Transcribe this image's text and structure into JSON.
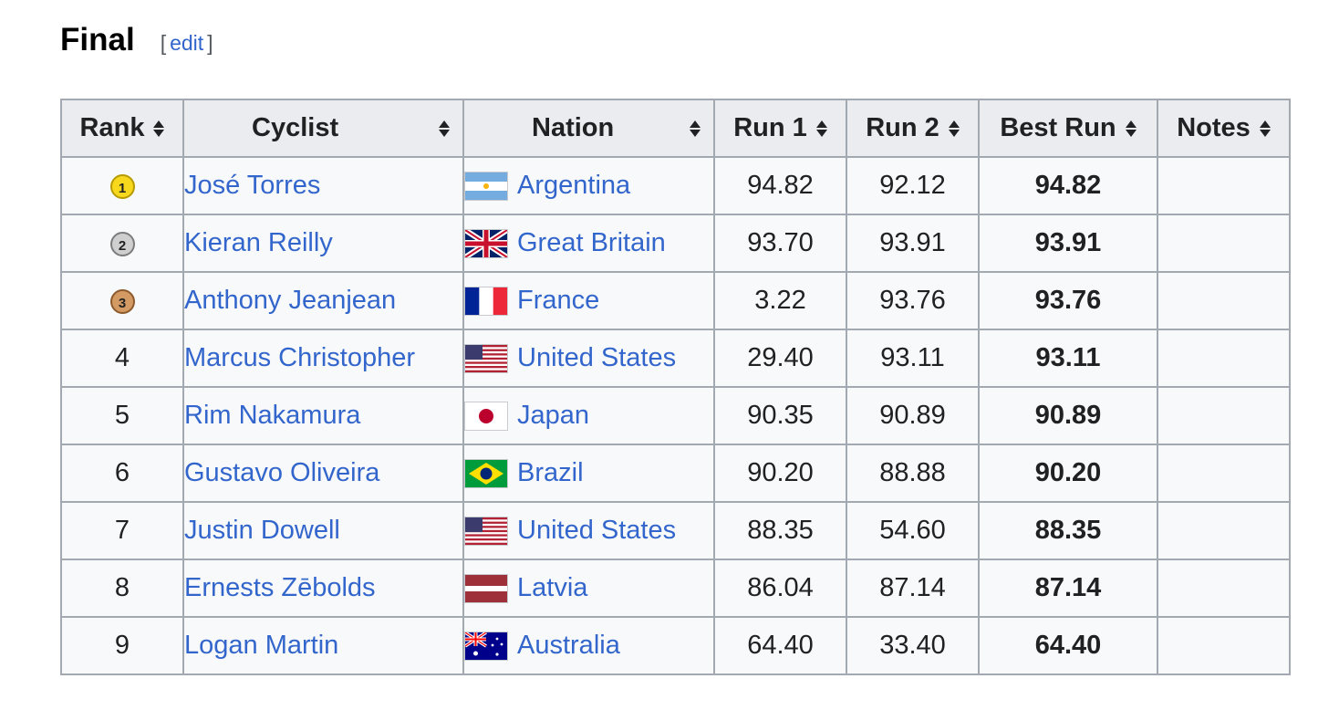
{
  "section": {
    "title": "Final",
    "edit_open": "[",
    "edit_label": "edit",
    "edit_close": "]"
  },
  "table": {
    "headers": [
      "Rank",
      "Cyclist",
      "Nation",
      "Run 1",
      "Run 2",
      "Best Run",
      "Notes"
    ],
    "rows": [
      {
        "rank": "1",
        "medal": "gold",
        "cyclist": "José Torres",
        "nation": "Argentina",
        "flag": "argentina-flag",
        "run1": "94.82",
        "run2": "92.12",
        "best": "94.82",
        "notes": ""
      },
      {
        "rank": "2",
        "medal": "silver",
        "cyclist": "Kieran Reilly",
        "nation": "Great Britain",
        "flag": "great-britain-flag",
        "run1": "93.70",
        "run2": "93.91",
        "best": "93.91",
        "notes": ""
      },
      {
        "rank": "3",
        "medal": "bronze",
        "cyclist": "Anthony Jeanjean",
        "nation": "France",
        "flag": "france-flag",
        "run1": "3.22",
        "run2": "93.76",
        "best": "93.76",
        "notes": ""
      },
      {
        "rank": "4",
        "medal": "",
        "cyclist": "Marcus Christopher",
        "nation": "United States",
        "flag": "united-states-flag",
        "run1": "29.40",
        "run2": "93.11",
        "best": "93.11",
        "notes": ""
      },
      {
        "rank": "5",
        "medal": "",
        "cyclist": "Rim Nakamura",
        "nation": "Japan",
        "flag": "japan-flag",
        "run1": "90.35",
        "run2": "90.89",
        "best": "90.89",
        "notes": ""
      },
      {
        "rank": "6",
        "medal": "",
        "cyclist": "Gustavo Oliveira",
        "nation": "Brazil",
        "flag": "brazil-flag",
        "run1": "90.20",
        "run2": "88.88",
        "best": "90.20",
        "notes": ""
      },
      {
        "rank": "7",
        "medal": "",
        "cyclist": "Justin Dowell",
        "nation": "United States",
        "flag": "united-states-flag",
        "run1": "88.35",
        "run2": "54.60",
        "best": "88.35",
        "notes": ""
      },
      {
        "rank": "8",
        "medal": "",
        "cyclist": "Ernests Zēbolds",
        "nation": "Latvia",
        "flag": "latvia-flag",
        "run1": "86.04",
        "run2": "87.14",
        "best": "87.14",
        "notes": ""
      },
      {
        "rank": "9",
        "medal": "",
        "cyclist": "Logan Martin",
        "nation": "Australia",
        "flag": "australia-flag",
        "run1": "64.40",
        "run2": "33.40",
        "best": "64.40",
        "notes": ""
      }
    ]
  },
  "colors": {
    "link": "#3366cc",
    "header_bg": "#eaecf0",
    "cell_bg": "#f8f9fa",
    "border": "#a2a9b1",
    "gold": "#f7d81d",
    "silver": "#cfcfcf",
    "bronze": "#d49a64"
  }
}
